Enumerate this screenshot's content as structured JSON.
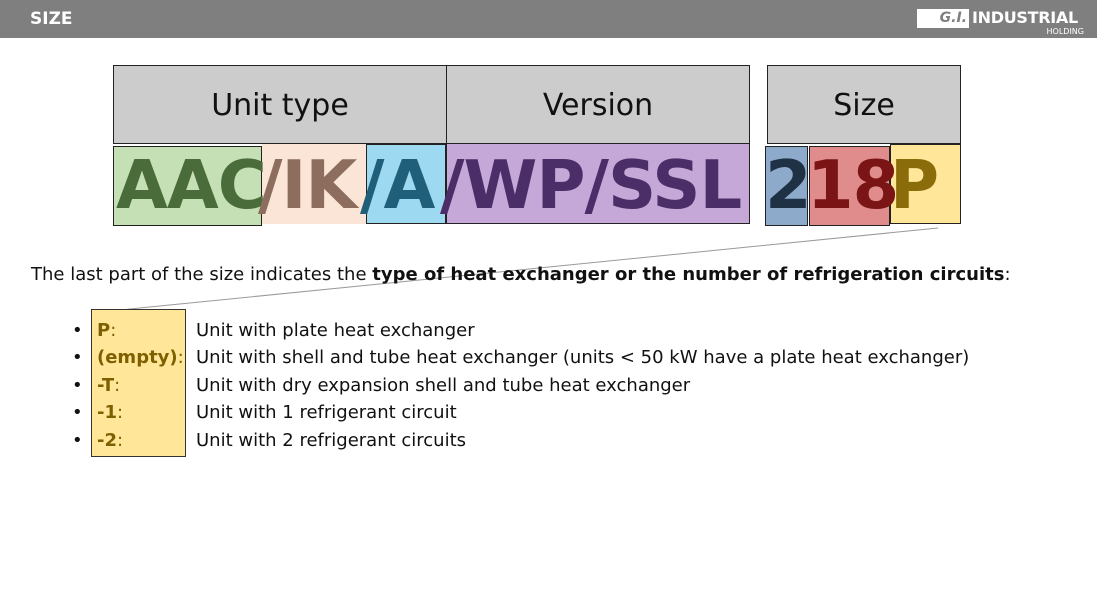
{
  "header": {
    "title": "SIZE"
  },
  "logo": {
    "mark": "G.I.",
    "word": "INDUSTRIAL",
    "sub": "HOLDING"
  },
  "columns": [
    {
      "label": "Unit type"
    },
    {
      "label": "Version"
    },
    {
      "label": "Size"
    }
  ],
  "code_segments": [
    {
      "text": "AAC",
      "bg": "#c5e0b4",
      "color": "#4a6b3a"
    },
    {
      "text": "/IK",
      "bg": "#fbe5d6",
      "color": "#8d6e5e"
    },
    {
      "text": "/A",
      "bg": "#9dd9f0",
      "color": "#1f5f7a"
    },
    {
      "text": "/WP/SSL",
      "bg": "#c5a8d8",
      "color": "#4b2e67"
    },
    {
      "text": "2",
      "bg": "#8eaacb",
      "color": "#1f3144"
    },
    {
      "text": "18",
      "bg": "#e08c8c",
      "color": "#7b1414"
    },
    {
      "text": "P",
      "bg": "#ffe699",
      "color": "#8a6d0a"
    }
  ],
  "intro": {
    "prefix": "The last part of the size indicates the ",
    "bold": "type of heat exchanger or the number of refrigeration circuits",
    "suffix": ":"
  },
  "bullet_glyph": "•",
  "options": [
    {
      "key": "P",
      "colon": ":",
      "desc": "Unit with plate heat exchanger"
    },
    {
      "key": "(empty)",
      "colon": ":",
      "desc": "Unit with shell and tube heat exchanger (units < 50 kW have a plate heat exchanger)"
    },
    {
      "key": "-T",
      "colon": ":",
      "desc": "Unit with dry expansion shell and tube heat exchanger"
    },
    {
      "key": "-1",
      "colon": ":",
      "desc": "Unit with 1 refrigerant circuit"
    },
    {
      "key": "-2",
      "colon": ":",
      "desc": "Unit with 2 refrigerant circuits"
    }
  ],
  "colors": {
    "header_bg": "#7f7f7f",
    "column_bg": "#cccccc",
    "key_highlight": "#ffe699",
    "key_text": "#7f6000"
  }
}
